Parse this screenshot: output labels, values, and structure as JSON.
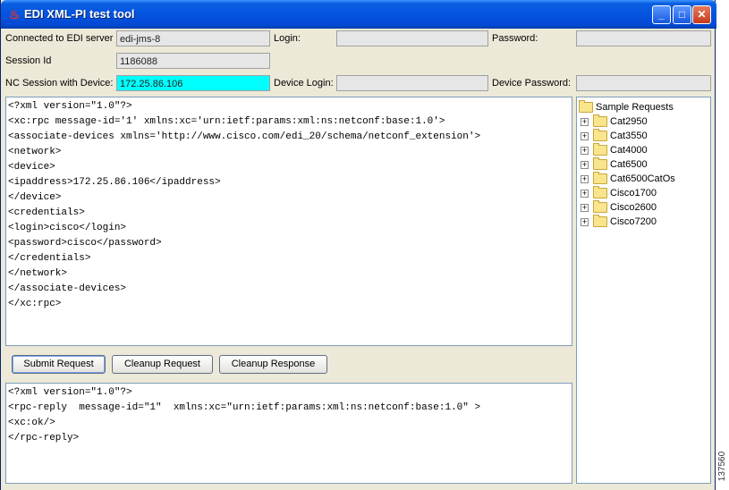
{
  "window": {
    "title": "EDI XML-PI test tool",
    "minimize_label": "_",
    "maximize_label": "□",
    "close_label": "✕"
  },
  "form": {
    "edi_server": {
      "label": "Connected to EDI server",
      "value": "edi-jms-8"
    },
    "login": {
      "label": "Login:",
      "value": ""
    },
    "password": {
      "label": "Password:",
      "value": ""
    },
    "session_id": {
      "label": "Session Id",
      "value": "1186088"
    },
    "nc_session": {
      "label": "NC Session with Device:",
      "value": "172.25.86.106"
    },
    "device_login": {
      "label": "Device Login:",
      "value": ""
    },
    "device_password": {
      "label": "Device Password:",
      "value": ""
    }
  },
  "request": {
    "lines": [
      "<?xml version=\"1.0\"?>",
      "<xc:rpc message-id='1' xmlns:xc='urn:ietf:params:xml:ns:netconf:base:1.0'>",
      "<associate-devices xmlns='http://www.cisco.com/edi_20/schema/netconf_extension'>",
      "<network>",
      "<device>",
      "<ipaddress>172.25.86.106</ipaddress>",
      "</device>",
      "<credentials>",
      "<login>cisco</login>",
      "<password>cisco</password>",
      "</credentials>",
      "</network>",
      "</associate-devices>",
      "</xc:rpc>"
    ]
  },
  "buttons": {
    "submit": "Submit Request",
    "cleanup_request": "Cleanup Request",
    "cleanup_response": "Cleanup Response"
  },
  "response": {
    "lines": [
      "<?xml version=\"1.0\"?>",
      "<rpc-reply  message-id=\"1\"  xmlns:xc=\"urn:ietf:params:xml:ns:netconf:base:1.0\" >",
      "<xc:ok/>",
      "</rpc-reply>"
    ]
  },
  "tree": {
    "root": "Sample Requests",
    "expander": "+",
    "nodes": [
      "Cat2950",
      "Cat3550",
      "Cat4000",
      "Cat6500",
      "Cat6500CatOs",
      "Cisco1700",
      "Cisco2600",
      "Cisco7200"
    ]
  },
  "figure_id": "137560",
  "colors": {
    "highlight_field": "#00ffff",
    "titlebar": "#0454e0",
    "window_bg": "#ece9d8"
  }
}
